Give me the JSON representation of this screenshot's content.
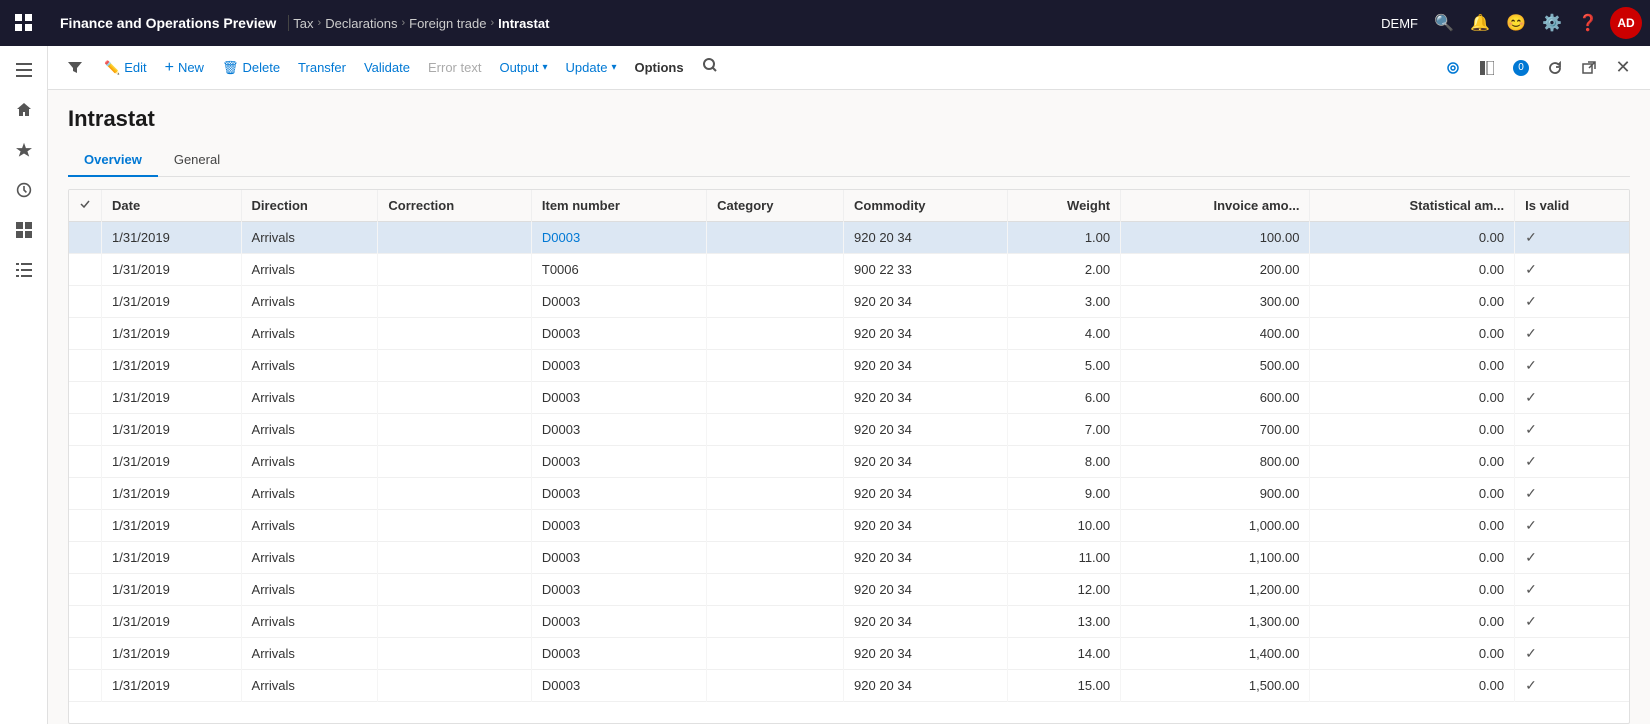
{
  "topNav": {
    "appTitle": "Finance and Operations Preview",
    "breadcrumbs": [
      "Tax",
      "Declarations",
      "Foreign trade",
      "Intrastat"
    ],
    "envLabel": "DEMF",
    "avatarLabel": "AD"
  },
  "actionBar": {
    "editLabel": "Edit",
    "newLabel": "New",
    "deleteLabel": "Delete",
    "transferLabel": "Transfer",
    "validateLabel": "Validate",
    "errorTextLabel": "Error text",
    "outputLabel": "Output",
    "updateLabel": "Update",
    "optionsLabel": "Options"
  },
  "page": {
    "title": "Intrastat",
    "tabs": [
      {
        "label": "Overview",
        "active": true
      },
      {
        "label": "General",
        "active": false
      }
    ]
  },
  "table": {
    "columns": [
      {
        "key": "check",
        "label": ""
      },
      {
        "key": "date",
        "label": "Date"
      },
      {
        "key": "direction",
        "label": "Direction"
      },
      {
        "key": "correction",
        "label": "Correction"
      },
      {
        "key": "itemNumber",
        "label": "Item number"
      },
      {
        "key": "category",
        "label": "Category"
      },
      {
        "key": "commodity",
        "label": "Commodity"
      },
      {
        "key": "weight",
        "label": "Weight",
        "numeric": true
      },
      {
        "key": "invoiceAmo",
        "label": "Invoice amo...",
        "numeric": true
      },
      {
        "key": "statisticalAm",
        "label": "Statistical am...",
        "numeric": true
      },
      {
        "key": "isValid",
        "label": "Is valid"
      }
    ],
    "rows": [
      {
        "date": "1/31/2019",
        "direction": "Arrivals",
        "correction": "",
        "itemNumber": "D0003",
        "category": "",
        "commodity": "920 20 34",
        "weight": "1.00",
        "invoiceAmo": "100.00",
        "statisticalAm": "0.00",
        "isValid": "✓",
        "selected": true,
        "itemLink": true
      },
      {
        "date": "1/31/2019",
        "direction": "Arrivals",
        "correction": "",
        "itemNumber": "T0006",
        "category": "",
        "commodity": "900 22 33",
        "weight": "2.00",
        "invoiceAmo": "200.00",
        "statisticalAm": "0.00",
        "isValid": "✓",
        "selected": false
      },
      {
        "date": "1/31/2019",
        "direction": "Arrivals",
        "correction": "",
        "itemNumber": "D0003",
        "category": "",
        "commodity": "920 20 34",
        "weight": "3.00",
        "invoiceAmo": "300.00",
        "statisticalAm": "0.00",
        "isValid": "✓",
        "selected": false
      },
      {
        "date": "1/31/2019",
        "direction": "Arrivals",
        "correction": "",
        "itemNumber": "D0003",
        "category": "",
        "commodity": "920 20 34",
        "weight": "4.00",
        "invoiceAmo": "400.00",
        "statisticalAm": "0.00",
        "isValid": "✓",
        "selected": false
      },
      {
        "date": "1/31/2019",
        "direction": "Arrivals",
        "correction": "",
        "itemNumber": "D0003",
        "category": "",
        "commodity": "920 20 34",
        "weight": "5.00",
        "invoiceAmo": "500.00",
        "statisticalAm": "0.00",
        "isValid": "✓",
        "selected": false
      },
      {
        "date": "1/31/2019",
        "direction": "Arrivals",
        "correction": "",
        "itemNumber": "D0003",
        "category": "",
        "commodity": "920 20 34",
        "weight": "6.00",
        "invoiceAmo": "600.00",
        "statisticalAm": "0.00",
        "isValid": "✓",
        "selected": false
      },
      {
        "date": "1/31/2019",
        "direction": "Arrivals",
        "correction": "",
        "itemNumber": "D0003",
        "category": "",
        "commodity": "920 20 34",
        "weight": "7.00",
        "invoiceAmo": "700.00",
        "statisticalAm": "0.00",
        "isValid": "✓",
        "selected": false
      },
      {
        "date": "1/31/2019",
        "direction": "Arrivals",
        "correction": "",
        "itemNumber": "D0003",
        "category": "",
        "commodity": "920 20 34",
        "weight": "8.00",
        "invoiceAmo": "800.00",
        "statisticalAm": "0.00",
        "isValid": "✓",
        "selected": false
      },
      {
        "date": "1/31/2019",
        "direction": "Arrivals",
        "correction": "",
        "itemNumber": "D0003",
        "category": "",
        "commodity": "920 20 34",
        "weight": "9.00",
        "invoiceAmo": "900.00",
        "statisticalAm": "0.00",
        "isValid": "✓",
        "selected": false
      },
      {
        "date": "1/31/2019",
        "direction": "Arrivals",
        "correction": "",
        "itemNumber": "D0003",
        "category": "",
        "commodity": "920 20 34",
        "weight": "10.00",
        "invoiceAmo": "1,000.00",
        "statisticalAm": "0.00",
        "isValid": "✓",
        "selected": false
      },
      {
        "date": "1/31/2019",
        "direction": "Arrivals",
        "correction": "",
        "itemNumber": "D0003",
        "category": "",
        "commodity": "920 20 34",
        "weight": "11.00",
        "invoiceAmo": "1,100.00",
        "statisticalAm": "0.00",
        "isValid": "✓",
        "selected": false
      },
      {
        "date": "1/31/2019",
        "direction": "Arrivals",
        "correction": "",
        "itemNumber": "D0003",
        "category": "",
        "commodity": "920 20 34",
        "weight": "12.00",
        "invoiceAmo": "1,200.00",
        "statisticalAm": "0.00",
        "isValid": "✓",
        "selected": false
      },
      {
        "date": "1/31/2019",
        "direction": "Arrivals",
        "correction": "",
        "itemNumber": "D0003",
        "category": "",
        "commodity": "920 20 34",
        "weight": "13.00",
        "invoiceAmo": "1,300.00",
        "statisticalAm": "0.00",
        "isValid": "✓",
        "selected": false
      },
      {
        "date": "1/31/2019",
        "direction": "Arrivals",
        "correction": "",
        "itemNumber": "D0003",
        "category": "",
        "commodity": "920 20 34",
        "weight": "14.00",
        "invoiceAmo": "1,400.00",
        "statisticalAm": "0.00",
        "isValid": "✓",
        "selected": false
      },
      {
        "date": "1/31/2019",
        "direction": "Arrivals",
        "correction": "",
        "itemNumber": "D0003",
        "category": "",
        "commodity": "920 20 34",
        "weight": "15.00",
        "invoiceAmo": "1,500.00",
        "statisticalAm": "0.00",
        "isValid": "✓",
        "selected": false
      }
    ]
  },
  "sidebar": {
    "icons": [
      {
        "name": "menu-icon",
        "symbol": "☰"
      },
      {
        "name": "home-icon",
        "symbol": "⌂"
      },
      {
        "name": "favorites-icon",
        "symbol": "★"
      },
      {
        "name": "recent-icon",
        "symbol": "⏱"
      },
      {
        "name": "workspaces-icon",
        "symbol": "⊞"
      },
      {
        "name": "list-icon",
        "symbol": "☰"
      }
    ]
  }
}
